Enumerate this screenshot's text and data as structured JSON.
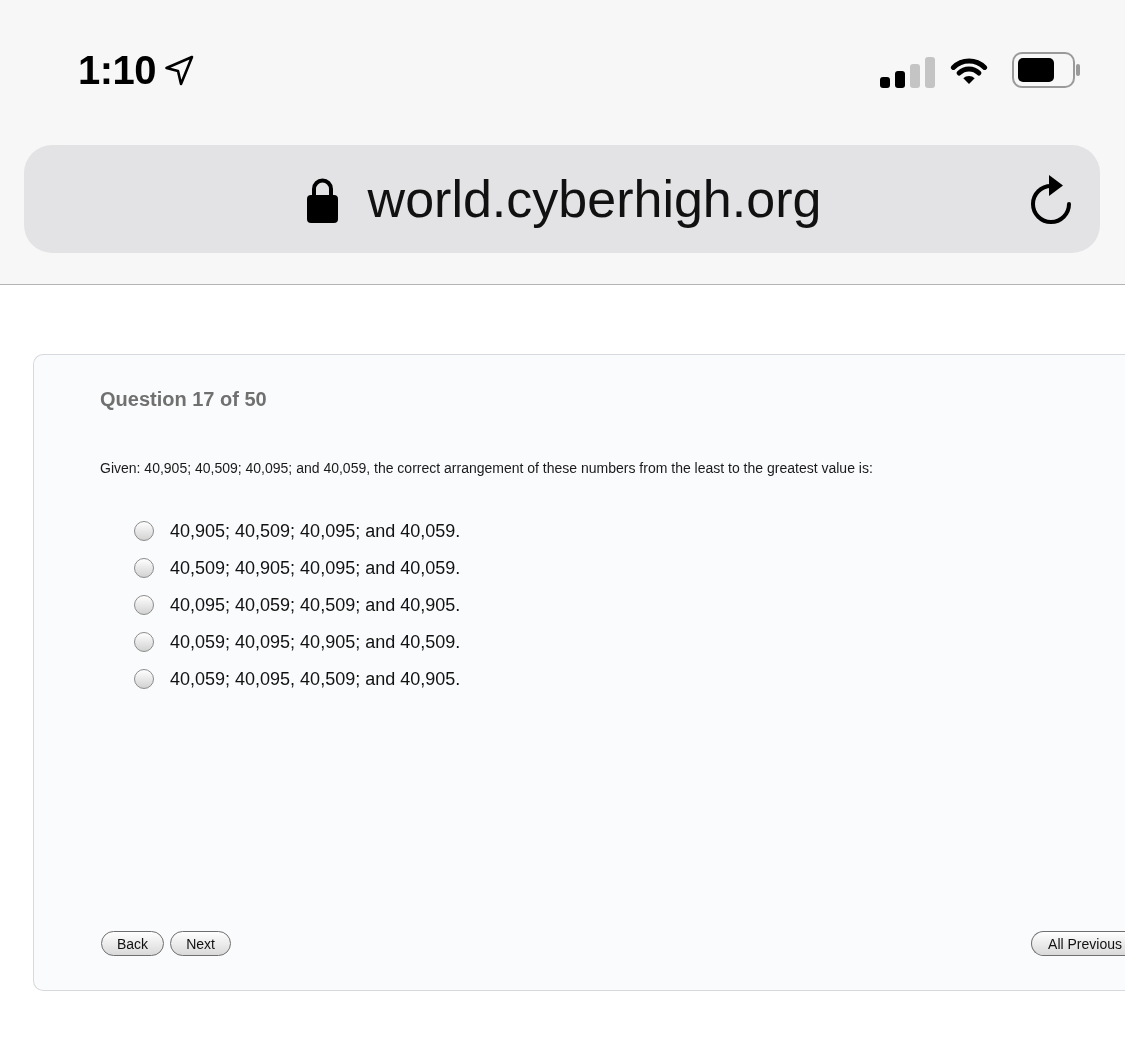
{
  "status_bar": {
    "time": "1:10"
  },
  "address_bar": {
    "url": "world.cyberhigh.org"
  },
  "quiz": {
    "heading": "Question 17 of 50",
    "question": "Given: 40,905; 40,509; 40,095; and 40,059, the correct arrangement of these numbers from the least to the greatest value is:",
    "options": [
      {
        "label": "40,905; 40,509; 40,095; and 40,059.",
        "selected": false
      },
      {
        "label": "40,509; 40,905; 40,095; and 40,059.",
        "selected": false
      },
      {
        "label": "40,095; 40,059; 40,509; and 40,905.",
        "selected": false
      },
      {
        "label": "40,059; 40,095; 40,905; and 40,509.",
        "selected": false
      },
      {
        "label": "40,059; 40,095, 40,509; and 40,905.",
        "selected": false
      }
    ],
    "nav_buttons": [
      {
        "label": "Back"
      },
      {
        "label": "Next"
      }
    ],
    "review_button": {
      "label": "All Previous"
    }
  }
}
